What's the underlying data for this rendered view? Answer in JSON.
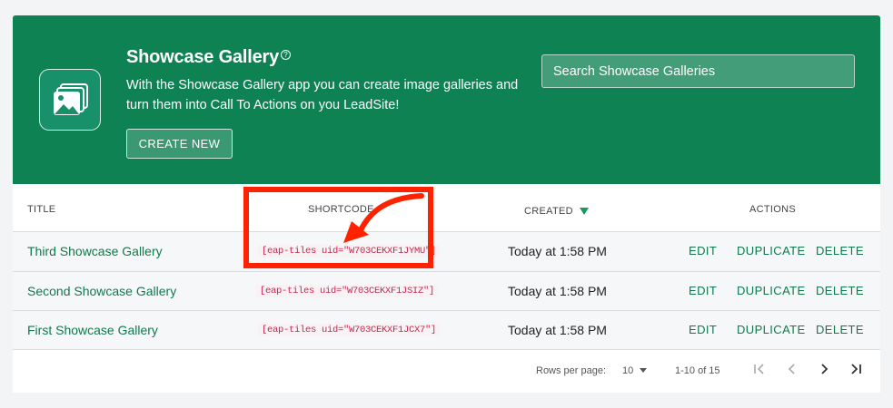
{
  "header": {
    "title": "Showcase Gallery",
    "help_icon": "help-circle-icon",
    "description": "With the Showcase Gallery app you can create image galleries and turn them into Call To Actions on you LeadSite!",
    "create_label": "CREATE NEW",
    "search_placeholder": "Search Showcase Galleries",
    "app_icon": "image-gallery-icon",
    "color": "#0f8254"
  },
  "table": {
    "columns": [
      "TITLE",
      "SHORTCODE",
      "CREATED",
      "ACTIONS"
    ],
    "sort_indicator": "sort-desc-icon",
    "rows": [
      {
        "title": "Third Showcase Gallery",
        "shortcode": "[eap-tiles uid=\"W703CEKXF1JYMU\"]",
        "created": "Today at 1:58 PM",
        "edit": "EDIT",
        "duplicate": "DUPLICATE",
        "delete": "DELETE"
      },
      {
        "title": "Second Showcase Gallery",
        "shortcode": "[eap-tiles uid=\"W703CEKXF1JSIZ\"]",
        "created": "Today at 1:58 PM",
        "edit": "EDIT",
        "duplicate": "DUPLICATE",
        "delete": "DELETE"
      },
      {
        "title": "First Showcase Gallery",
        "shortcode": "[eap-tiles uid=\"W703CEKXF1JCX7\"]",
        "created": "Today at 1:58 PM",
        "edit": "EDIT",
        "duplicate": "DUPLICATE",
        "delete": "DELETE"
      }
    ],
    "pagination": {
      "rows_per_page_label": "Rows per page:",
      "rows_per_page": "10",
      "range": "1-10 of 15",
      "icons": [
        "first-page-icon",
        "previous-page-icon",
        "next-page-icon",
        "last-page-icon"
      ]
    }
  },
  "annotation": {
    "color": "#ff2200",
    "arrow_icon": "curved-arrow-icon"
  }
}
